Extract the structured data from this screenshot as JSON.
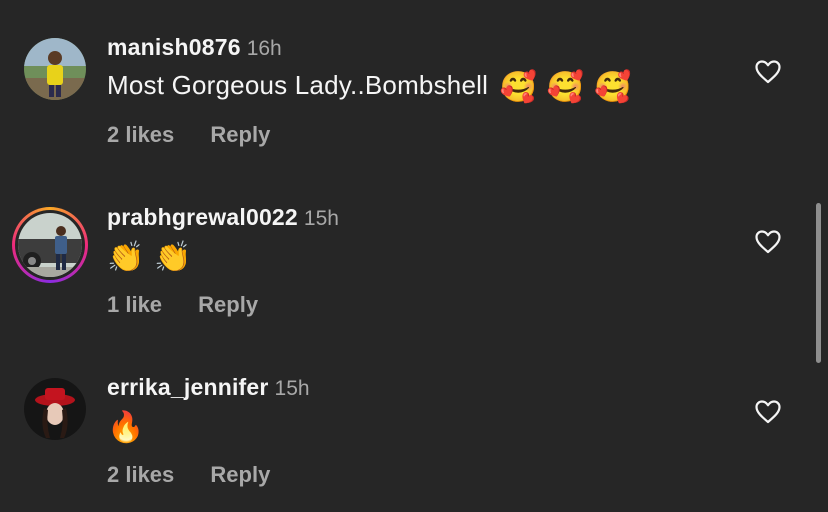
{
  "comments": [
    {
      "username": "manish0876",
      "time": "16h",
      "text": "Most Gorgeous Lady..Bombshell",
      "emojis": "🥰 🥰 🥰",
      "likes": "2 likes",
      "reply": "Reply",
      "avatar_icon": "user-photo-yellow-shirt",
      "has_story_ring": false
    },
    {
      "username": "prabhgrewal0022",
      "time": "15h",
      "text": "",
      "emojis": "👏 👏",
      "likes": "1 like",
      "reply": "Reply",
      "avatar_icon": "user-photo-standing-by-car",
      "has_story_ring": true
    },
    {
      "username": "errika_jennifer",
      "time": "15h",
      "text": "",
      "emojis": "🔥",
      "likes": "2 likes",
      "reply": "Reply",
      "avatar_icon": "user-photo-red-hat",
      "has_story_ring": false
    }
  ],
  "colors": {
    "background": "#262626",
    "primary_text": "#f5f5f5",
    "secondary_text": "#a8a8a8",
    "story_ring_start": "#f9a825",
    "story_ring_end": "#ee2a7b"
  },
  "icons": {
    "like": "heart-outline-icon"
  }
}
